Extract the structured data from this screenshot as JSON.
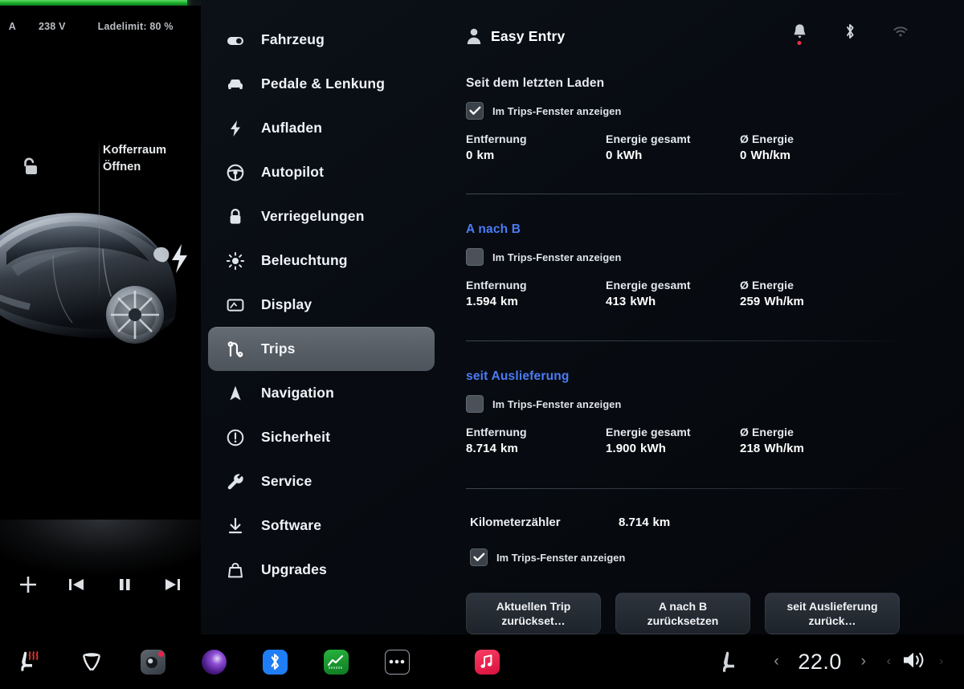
{
  "status_bar": {
    "amperage": "A",
    "voltage": "238 V",
    "charge_limit": "Ladelimit: 80 %",
    "charge_percent": 93
  },
  "left_panel": {
    "trunk_line1": "Kofferraum",
    "trunk_line2": "Öffnen",
    "unlock_icon": "unlock-icon",
    "car_image": "tesla-model-y-rear",
    "charge_port_icon": "charge-bolt-icon",
    "media": [
      {
        "name": "add-to-favorites-button",
        "icon": "plus-icon"
      },
      {
        "name": "previous-track-button",
        "icon": "skip-back-icon"
      },
      {
        "name": "play-pause-button",
        "icon": "pause-icon"
      },
      {
        "name": "next-track-button",
        "icon": "skip-forward-icon"
      }
    ]
  },
  "sidebar": {
    "items": [
      {
        "label": "Fahrzeug",
        "icon": "car-toggle-icon",
        "key": "fahrzeug",
        "selected": false
      },
      {
        "label": "Pedale & Lenkung",
        "icon": "car-front-icon",
        "key": "pedale",
        "selected": false
      },
      {
        "label": "Aufladen",
        "icon": "bolt-icon",
        "key": "aufladen",
        "selected": false
      },
      {
        "label": "Autopilot",
        "icon": "steering-icon",
        "key": "autopilot",
        "selected": false
      },
      {
        "label": "Verriegelungen",
        "icon": "lock-icon",
        "key": "verriegelungen",
        "selected": false
      },
      {
        "label": "Beleuchtung",
        "icon": "sun-icon",
        "key": "beleuchtung",
        "selected": false
      },
      {
        "label": "Display",
        "icon": "display-icon",
        "key": "display",
        "selected": false
      },
      {
        "label": "Trips",
        "icon": "trips-icon",
        "key": "trips",
        "selected": true
      },
      {
        "label": "Navigation",
        "icon": "navigation-icon",
        "key": "navigation",
        "selected": false
      },
      {
        "label": "Sicherheit",
        "icon": "alert-circle-icon",
        "key": "sicherheit",
        "selected": false
      },
      {
        "label": "Service",
        "icon": "wrench-icon",
        "key": "service",
        "selected": false
      },
      {
        "label": "Software",
        "icon": "download-icon",
        "key": "software",
        "selected": false
      },
      {
        "label": "Upgrades",
        "icon": "shop-bag-icon",
        "key": "upgrades",
        "selected": false
      }
    ]
  },
  "header": {
    "profile_icon": "person-icon",
    "profile_name": "Easy Entry",
    "status_icons": [
      {
        "name": "notifications-bell-icon",
        "badge": true
      },
      {
        "name": "bluetooth-icon",
        "badge": false
      },
      {
        "name": "wifi-icon",
        "badge": false
      }
    ]
  },
  "checkbox_label": "Im Trips-Fenster anzeigen",
  "sections": [
    {
      "title": "Seit dem letzten Laden",
      "title_style": "plain",
      "checked": true,
      "stats": [
        {
          "label": "Entfernung",
          "value": "0",
          "unit": "km"
        },
        {
          "label": "Energie gesamt",
          "value": "0",
          "unit": "kWh"
        },
        {
          "label": "Ø Energie",
          "value": "0",
          "unit": "Wh/km"
        }
      ]
    },
    {
      "title": "A nach B",
      "title_style": "link",
      "checked": false,
      "stats": [
        {
          "label": "Entfernung",
          "value": "1.594",
          "unit": "km"
        },
        {
          "label": "Energie gesamt",
          "value": "413",
          "unit": "kWh"
        },
        {
          "label": "Ø Energie",
          "value": "259",
          "unit": "Wh/km"
        }
      ]
    },
    {
      "title": "seit Auslieferung",
      "title_style": "link",
      "checked": false,
      "stats": [
        {
          "label": "Entfernung",
          "value": "8.714",
          "unit": "km"
        },
        {
          "label": "Energie gesamt",
          "value": "1.900",
          "unit": "kWh"
        },
        {
          "label": "Ø Energie",
          "value": "218",
          "unit": "Wh/km"
        }
      ]
    }
  ],
  "odometer": {
    "label": "Kilometerzähler",
    "value": "8.714",
    "unit": "km",
    "checked": true,
    "checkbox_label": "Im Trips-Fenster anzeigen"
  },
  "reset_buttons": [
    {
      "line1": "Aktuellen Trip",
      "line2": "zurückset…",
      "key": "reset-current-trip"
    },
    {
      "line1": "A nach B",
      "line2": "zurücksetzen",
      "key": "reset-a-to-b"
    },
    {
      "line1": "seit Auslieferung",
      "line2": "zurück…",
      "key": "reset-since-delivery"
    }
  ],
  "taskbar": {
    "left_icons": [
      {
        "name": "seat-heater-icon",
        "color": "#d9342b"
      },
      {
        "name": "wiper-icon",
        "color": "#e6eaee"
      },
      {
        "name": "dashcam-icon",
        "color": "#555c64"
      },
      {
        "name": "media-orb-icon",
        "color": "#6d2fa8"
      },
      {
        "name": "bluetooth-app-icon",
        "color": "#1f7ef5"
      },
      {
        "name": "energy-app-icon",
        "color": "#1a9c33"
      },
      {
        "name": "more-apps-icon",
        "color": "#e6eaee"
      }
    ],
    "music_icon": "music-app-icon",
    "music_color": "#e8244b",
    "seat-icon": "seat-icon",
    "temperature": "22.0",
    "chev_left": "‹",
    "chev_right": "›",
    "volume_icon": "volume-icon"
  },
  "colors": {
    "accent_blue": "#4a7cf5",
    "charge_green": "#2ec04a",
    "notification_red": "#e6314b",
    "selected_gray": "#565d65"
  }
}
